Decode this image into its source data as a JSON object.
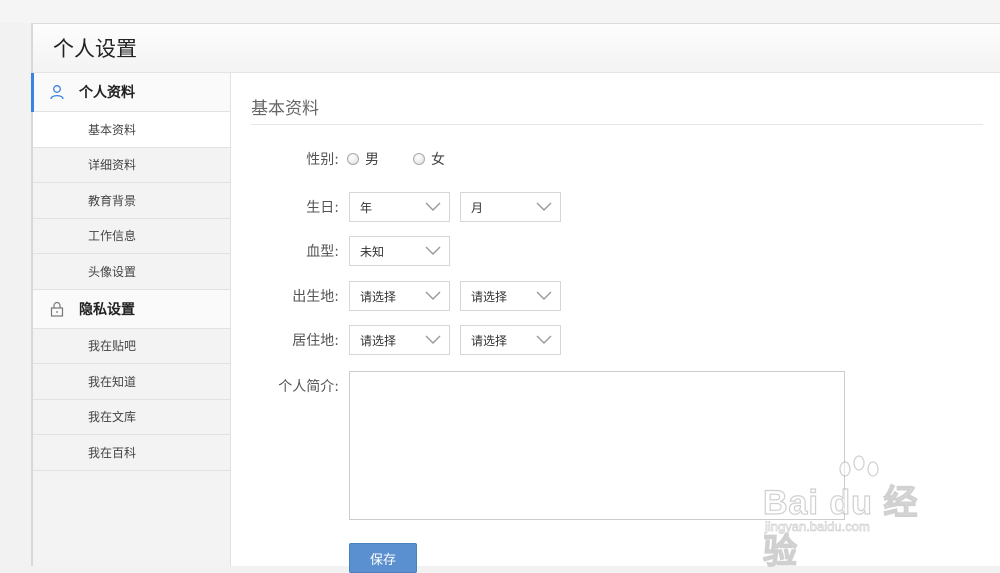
{
  "window": {
    "title": "个人设置"
  },
  "sidebar": {
    "sections": [
      {
        "label": "个人资料",
        "icon": "user-icon",
        "items": [
          "基本资料",
          "详细资料",
          "教育背景",
          "工作信息",
          "头像设置"
        ]
      },
      {
        "label": "隐私设置",
        "icon": "lock-icon",
        "items": [
          "我在贴吧",
          "我在知道",
          "我在文库",
          "我在百科"
        ]
      }
    ]
  },
  "main": {
    "title": "基本资料",
    "gender": {
      "label": "性别:",
      "options": [
        "男",
        "女"
      ]
    },
    "birthday": {
      "label": "生日:",
      "year": "年",
      "month": "月"
    },
    "blood": {
      "label": "血型:",
      "value": "未知"
    },
    "birthplace": {
      "label": "出生地:",
      "province": "请选择",
      "city": "请选择"
    },
    "residence": {
      "label": "居住地:",
      "province": "请选择",
      "city": "请选择"
    },
    "bio": {
      "label": "个人简介:",
      "value": ""
    },
    "save_label": "保存"
  },
  "watermark": {
    "brand": "Bai du 经验",
    "url": "jingyan.baidu.com"
  },
  "colors": {
    "accent": "#3a83e0",
    "button": "#5a8fd0"
  }
}
